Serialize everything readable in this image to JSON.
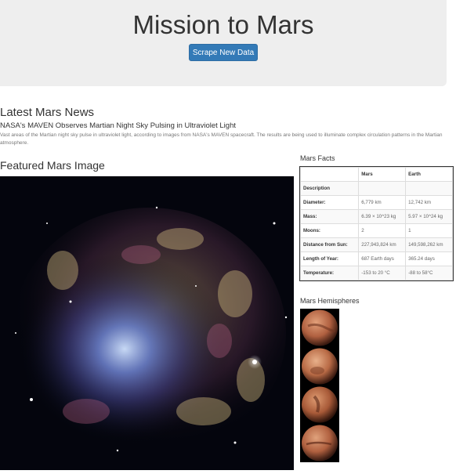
{
  "header": {
    "title": "Mission to Mars",
    "scrape_button_label": "Scrape New Data",
    "button_color": "#337ab7"
  },
  "news": {
    "heading": "Latest Mars News",
    "title": "NASA's MAVEN Observes Martian Night Sky Pulsing in Ultraviolet Light",
    "teaser": "Vast areas of the Martian night sky pulse in ultraviolet light, according to images from NASA's MAVEN spacecraft. The results are being used to illuminate complex circulation patterns in the Martian atmosphere."
  },
  "featured": {
    "heading": "Featured Mars Image",
    "image_subject": "spiral-galaxy-nebula"
  },
  "facts": {
    "heading": "Mars Facts",
    "columns": [
      "",
      "Mars",
      "Earth"
    ],
    "rows": [
      [
        "Description",
        "",
        ""
      ],
      [
        "Diameter:",
        "6,779 km",
        "12,742 km"
      ],
      [
        "Mass:",
        "6.39 × 10^23 kg",
        "5.97 × 10^24 kg"
      ],
      [
        "Moons:",
        "2",
        "1"
      ],
      [
        "Distance from Sun:",
        "227,943,824 km",
        "149,598,262 km"
      ],
      [
        "Length of Year:",
        "687 Earth days",
        "365.24 days"
      ],
      [
        "Temperature:",
        "-153 to 20 °C",
        "-88 to 58°C"
      ]
    ]
  },
  "hemispheres": {
    "heading": "Mars Hemispheres",
    "items": [
      "cerberus-hemisphere-thumbnail",
      "schiaparelli-hemisphere-thumbnail",
      "syrtis-major-hemisphere-thumbnail",
      "valles-marineris-hemisphere-thumbnail"
    ]
  }
}
